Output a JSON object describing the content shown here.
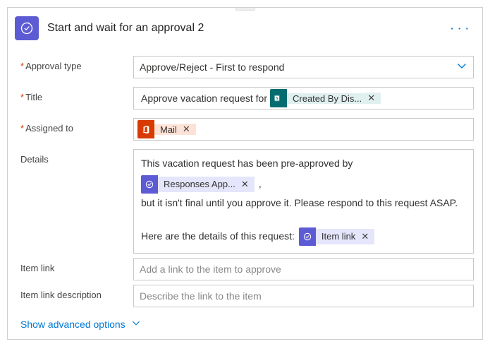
{
  "header": {
    "title": "Start and wait for an approval 2"
  },
  "fields": {
    "approval_type": {
      "label": "Approval type",
      "value": "Approve/Reject - First to respond"
    },
    "title": {
      "label": "Title",
      "prefix_text": "Approve vacation request for",
      "token": {
        "label": "Created By Dis...",
        "source": "sharepoint"
      }
    },
    "assigned_to": {
      "label": "Assigned to",
      "token": {
        "label": "Mail",
        "source": "office"
      }
    },
    "details": {
      "label": "Details",
      "text1": "This vacation request has been pre-approved by",
      "token1": {
        "label": "Responses App...",
        "source": "approvals"
      },
      "text1_suffix": ",",
      "text2": "but it isn't final until you approve it. Please respond to this request ASAP.",
      "text3": "Here are the details of this request:",
      "token2": {
        "label": "Item link",
        "source": "approvals"
      }
    },
    "item_link": {
      "label": "Item link",
      "placeholder": "Add a link to the item to approve"
    },
    "item_link_desc": {
      "label": "Item link description",
      "placeholder": "Describe the link to the item"
    }
  },
  "footer": {
    "advanced": "Show advanced options"
  }
}
